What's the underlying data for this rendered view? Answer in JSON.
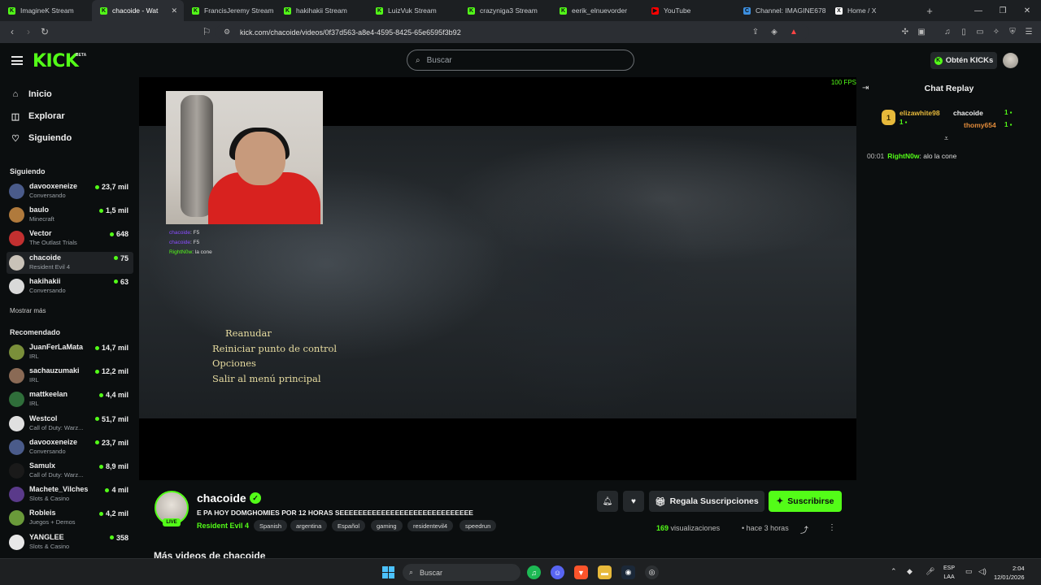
{
  "browser": {
    "tabs": [
      {
        "title": "ImagineK Stream",
        "fav_color": "#53fc18",
        "fav_glyph": "K"
      },
      {
        "title": "chacoide - Wat",
        "fav_color": "#53fc18",
        "fav_glyph": "K",
        "active": true
      },
      {
        "title": "FrancisJeremy Stream",
        "fav_color": "#53fc18",
        "fav_glyph": "K"
      },
      {
        "title": "hakihakii Stream",
        "fav_color": "#53fc18",
        "fav_glyph": "K"
      },
      {
        "title": "LuizVuk Stream",
        "fav_color": "#53fc18",
        "fav_glyph": "K"
      },
      {
        "title": "crazyniga3 Stream",
        "fav_color": "#53fc18",
        "fav_glyph": "K"
      },
      {
        "title": "eerik_elnuevorder",
        "fav_color": "#53fc18",
        "fav_glyph": "K"
      },
      {
        "title": "YouTube",
        "fav_color": "#ff0000",
        "fav_glyph": "▶"
      },
      {
        "title": "Channel: IMAGINE678",
        "fav_color": "#3d8fe0",
        "fav_glyph": "C"
      },
      {
        "title": "Home / X",
        "fav_color": "#ffffff",
        "fav_glyph": "X"
      }
    ],
    "new_tab": "+",
    "url": "kick.com/chacoide/videos/0f37d563-a8e4-4595-8425-65e6595f3b92"
  },
  "header": {
    "logo": "KICK",
    "beta": "BETA",
    "search_placeholder": "Buscar",
    "get_kicks": "Obtén KICKs"
  },
  "sidebar": {
    "nav": [
      {
        "label": "Inicio",
        "icon": "home-icon",
        "glyph": "⌂"
      },
      {
        "label": "Explorar",
        "icon": "compass-icon",
        "glyph": "◫"
      },
      {
        "label": "Siguiendo",
        "icon": "heart-icon",
        "glyph": "♡"
      }
    ],
    "following_title": "Siguiendo",
    "following": [
      {
        "name": "davooxeneize",
        "category": "Conversando",
        "viewers": "23,7 mil",
        "color": "#4a5b8a"
      },
      {
        "name": "baulo",
        "category": "Minecraft",
        "viewers": "1,5 mil",
        "color": "#b07a3c"
      },
      {
        "name": "Vector",
        "category": "The Outlast Trials",
        "viewers": "648",
        "color": "#c23030"
      },
      {
        "name": "chacoide",
        "category": "Resident Evil 4",
        "viewers": "75",
        "color": "#c9c2b8",
        "active": true
      },
      {
        "name": "hakihakii",
        "category": "Conversando",
        "viewers": "63",
        "color": "#d9d9d9"
      }
    ],
    "show_more": "Mostrar más",
    "recommended_title": "Recomendado",
    "recommended": [
      {
        "name": "JuanFerLaMata",
        "category": "IRL",
        "viewers": "14,7 mil",
        "color": "#7a8f3a"
      },
      {
        "name": "sachauzumaki",
        "category": "IRL",
        "viewers": "12,2 mil",
        "color": "#8a6a55"
      },
      {
        "name": "mattkeelan",
        "category": "IRL",
        "viewers": "4,4 mil",
        "color": "#2f6e3a"
      },
      {
        "name": "Westcol",
        "category": "Call of Duty: Warz...",
        "viewers": "51,7 mil",
        "color": "#e0e0e0"
      },
      {
        "name": "davooxeneize",
        "category": "Conversando",
        "viewers": "23,7 mil",
        "color": "#4a5b8a"
      },
      {
        "name": "Samulx",
        "category": "Call of Duty: Warz...",
        "viewers": "8,9 mil",
        "color": "#1a1a1a"
      },
      {
        "name": "Machete_Vilches",
        "category": "Slots & Casino",
        "viewers": "4 mil",
        "color": "#5a3a8a"
      },
      {
        "name": "Robleis",
        "category": "Juegos + Demos",
        "viewers": "4,2 mil",
        "color": "#6a9a3a"
      },
      {
        "name": "YANGLEE",
        "category": "Slots & Casino",
        "viewers": "358",
        "color": "#e8e8e8"
      }
    ]
  },
  "video": {
    "fps": "100 FPS",
    "overlay_chat": [
      {
        "user": "chacoide",
        "text": ": F5"
      },
      {
        "user": "chacoide",
        "text": ": F5"
      },
      {
        "user": "RightN0w",
        "text": ": la cone"
      }
    ],
    "pause_menu": [
      "Reanudar",
      "Reiniciar punto de control",
      "Opciones",
      "Salir al menú principal"
    ]
  },
  "chat": {
    "title": "Chat Replay",
    "pinned": {
      "rank": "1",
      "top": {
        "name": "elizawhite98",
        "count": "1",
        "color": "#e7b93b"
      },
      "second": {
        "name": "chacoide",
        "count": "1",
        "color": "#eeeeee"
      },
      "third": {
        "name": "thomy654",
        "count": "1",
        "color": "#e08a3a"
      }
    },
    "messages": [
      {
        "time": "00:01",
        "user": "RightN0w",
        "text": "alo la cone"
      }
    ]
  },
  "stream": {
    "channel": "chacoide",
    "live": "LIVE",
    "title": "E PA HOY DOMGHOMIES POR 12 HORAS SEEEEEEEEEEEEEEEEEEEEEEEEEEEEE",
    "category": "Resident Evil 4",
    "tags": [
      "Spanish",
      "argentina",
      "Español",
      "gaming",
      "residentevil4",
      "speedrun"
    ],
    "gift_label": "Regala Suscripciones",
    "subscribe_label": "Suscribirse",
    "views_count": "169",
    "views_label": "visualizaciones",
    "ago": "hace 3 horas",
    "more_videos": "Más videos de chacoide"
  },
  "taskbar": {
    "search": "Buscar",
    "lang_top": "ESP",
    "lang_bottom": "LAA",
    "time": "2:04",
    "date": "12/01/2026"
  },
  "colors": {
    "accent": "#53fc18",
    "bg": "#0b0e0f"
  }
}
